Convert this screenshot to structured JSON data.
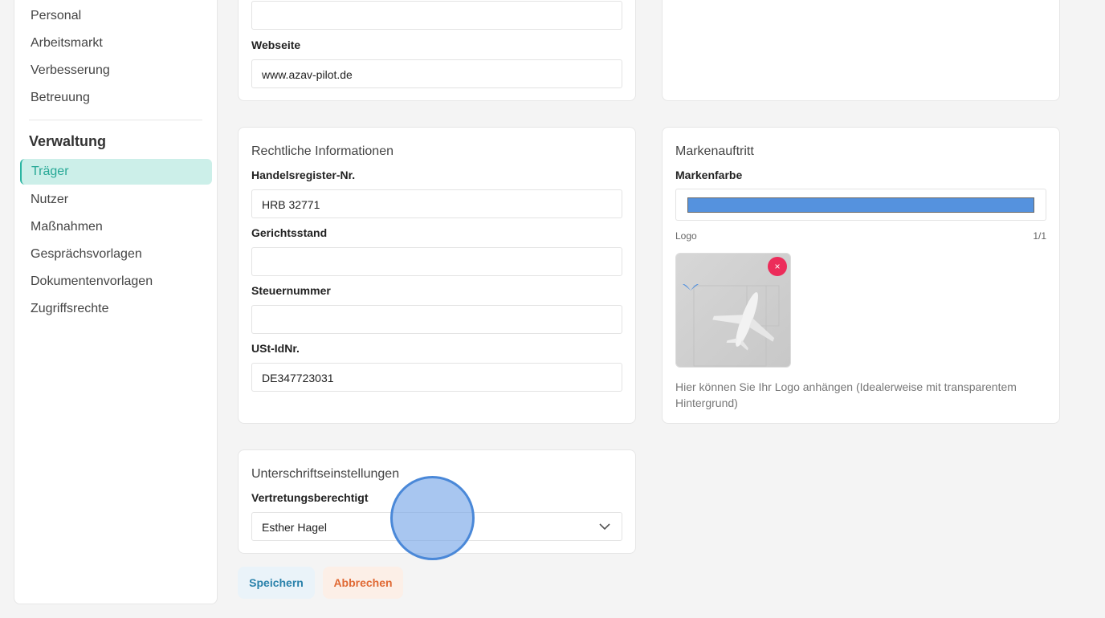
{
  "sidebar": {
    "items_top": [
      "Personal",
      "Arbeitsmarkt",
      "Verbesserung",
      "Betreuung"
    ],
    "section_title": "Verwaltung",
    "active_item": "Träger",
    "items_bottom": [
      "Nutzer",
      "Maßnahmen",
      "Gesprächsvorlagen",
      "Dokumentenvorlagen",
      "Zugriffsrechte"
    ]
  },
  "contact_card": {
    "website_label": "Webseite",
    "website_value": "www.azav-pilot.de",
    "previous_field_value": ""
  },
  "legal_card": {
    "title": "Rechtliche Informationen",
    "register_label": "Handelsregister-Nr.",
    "register_value": "HRB 32771",
    "court_label": "Gerichtsstand",
    "court_value": "",
    "tax_label": "Steuernummer",
    "tax_value": "",
    "vat_label": "USt-IdNr.",
    "vat_value": "DE347723031"
  },
  "brand_card": {
    "title": "Markenauftritt",
    "color_label": "Markenfarbe",
    "color_value": "#5592de",
    "logo_label": "Logo",
    "logo_count": "1/1",
    "remove_icon": "×",
    "hint": "Hier können Sie Ihr Logo anhängen (Idealerweise mit transparentem Hintergrund)"
  },
  "signature_card": {
    "title": "Unterschriftseinstellungen",
    "representative_label": "Vertretungsberechtigt",
    "representative_value": "Esther Hagel"
  },
  "actions": {
    "save_label": "Speichern",
    "cancel_label": "Abbrechen"
  },
  "colors": {
    "accent": "#2bb5a2",
    "save": "#2a82ab",
    "cancel": "#e06a35",
    "remove": "#ec2c5a"
  }
}
